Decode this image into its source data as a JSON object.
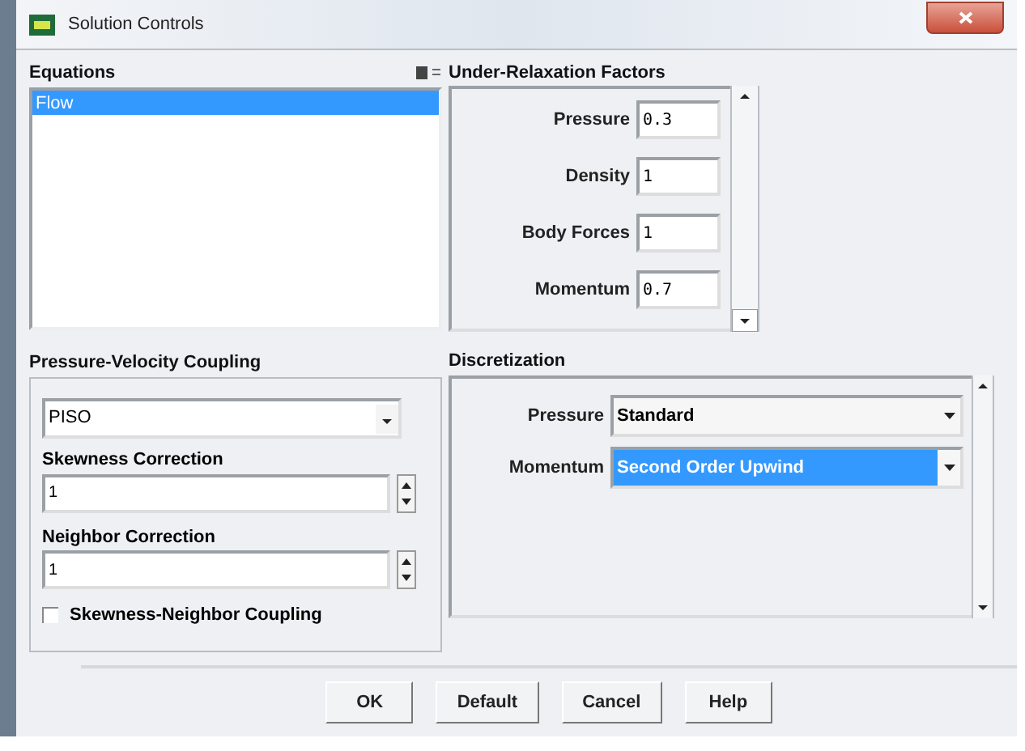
{
  "window": {
    "title": "Solution Controls"
  },
  "equations": {
    "title": "Equations",
    "items": [
      {
        "label": "Flow",
        "selected": true
      }
    ]
  },
  "pressure_velocity_coupling": {
    "title": "Pressure-Velocity Coupling",
    "scheme": "PISO",
    "skewness_correction": {
      "label": "Skewness Correction",
      "value": "1"
    },
    "neighbor_correction": {
      "label": "Neighbor Correction",
      "value": "1"
    },
    "skewness_neighbor_coupling": {
      "label": "Skewness-Neighbor Coupling",
      "checked": false
    }
  },
  "under_relaxation": {
    "title": "Under-Relaxation Factors",
    "factors": [
      {
        "label": "Pressure",
        "value": "0.3"
      },
      {
        "label": "Density",
        "value": "1"
      },
      {
        "label": "Body Forces",
        "value": "1"
      },
      {
        "label": "Momentum",
        "value": "0.7"
      }
    ]
  },
  "discretization": {
    "title": "Discretization",
    "rows": [
      {
        "label": "Pressure",
        "value": "Standard",
        "selected": false
      },
      {
        "label": "Momentum",
        "value": "Second Order Upwind",
        "selected": true
      }
    ]
  },
  "buttons": [
    "OK",
    "Default",
    "Cancel",
    "Help"
  ]
}
